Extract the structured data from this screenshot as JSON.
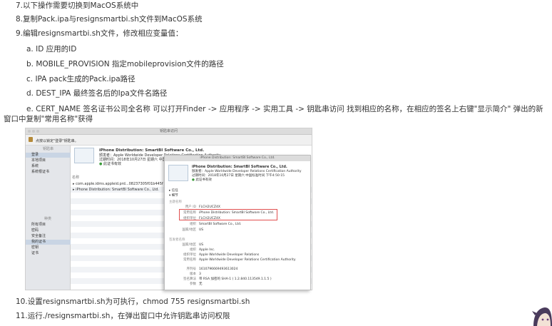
{
  "steps_top": [
    "7.以下操作需要切换到MacOS系统中",
    "8.复制Pack.ipa与resignsmartbi.sh文件到MacOS系统",
    "9.编辑resignsmartbi.sh文件，修改相应变量值："
  ],
  "sub_items": [
    "a. ID  应用的ID",
    "b. MOBILE_PROVISION  指定mobileprovision文件的路径",
    "c.  IPA pack生成的Pack.ipa路径",
    "d.  DEST_IPA 最终签名后的Ipa文件名路径",
    "e.  CERT_NAME 签名证书公司全名称 可以打开Finder -> 应用程序 -> 实用工具 -> 钥匙串访问 找到相应的名称，在相应的签名上右键\"显示简介\" 弹出的新窗口中复制\"常用名称\"获得"
  ],
  "steps_bottom": [
    "10.设置resignsmartbi.sh为可执行，chmod 755 resignsmartbi.sh",
    "11.运行./resignsmartbi.sh，在弹出窗口中允许钥匙串访问权限"
  ],
  "screenshot": {
    "window_title": "钥匙串访问",
    "lock_text": "点按以锁定\"登录\"钥匙串。",
    "sidebar_keychain_header": "钥匙串",
    "sidebar_keychains": [
      "登录",
      "本地项目",
      "系统",
      "系统根证书"
    ],
    "sidebar_category_header": "种类",
    "sidebar_categories": [
      "所有项目",
      "密码",
      "安全备注",
      "我的证书",
      "密钥",
      "证书"
    ],
    "cert_name": "iPhone Distribution: SmartBI Software Co., Ltd.",
    "cert_issuer": "颁发者：Apple Worldwide Developer Relations Certification Authority",
    "cert_expiry": "过期时间：2018年10月27日 星期六 中国标准时间",
    "cert_valid": "此证书有效",
    "list_header": "名称",
    "list_rows": [
      "com.apple.idms.appleid.prd...08237305f01b445f",
      "iPhone Distribution: SmartBI Software Co., Ltd."
    ],
    "detail": {
      "title": "iPhone Distribution: SmartBI Software Co., Ltd.",
      "cert_name": "iPhone Distribution: SmartBI Software Co., Ltd.",
      "cert_issuer": "颁发者：Apple Worldwide Developer Relations Certification Authority",
      "cert_expiry": "过期时间：2018年10月27日 星期六 中国标准时间 下午4:50:15",
      "cert_valid": "此证书有效",
      "trust": "信任",
      "details": "细节",
      "subject_header": "主题名称",
      "subject_rows": [
        {
          "label": "用户 ID",
          "value": "FLCH2UCZ4X"
        },
        {
          "label": "常用名称",
          "value": "iPhone Distribution: SmartBI Software Co., Ltd."
        },
        {
          "label": "组织单位",
          "value": "FLCH2UCZ4X"
        },
        {
          "label": "组织",
          "value": "SmartBI Software Co., Ltd."
        },
        {
          "label": "国家/地区",
          "value": "US"
        }
      ],
      "issuer_header": "签发者名称",
      "issuer_rows": [
        {
          "label": "国家/地区",
          "value": "US"
        },
        {
          "label": "组织",
          "value": "Apple Inc."
        },
        {
          "label": "组织单位",
          "value": "Apple Worldwide Developer Relations"
        },
        {
          "label": "常用名称",
          "value": "Apple Worldwide Developer Relations Certification Authority"
        }
      ],
      "extra_rows": [
        {
          "label": "序列号",
          "value": "1610796669493613024"
        },
        {
          "label": "版本",
          "value": "3"
        },
        {
          "label": "签名算法",
          "value": "带 RSA 加密的 SHA-1 ( 1.2.840.113549.1.1.5 )"
        },
        {
          "label": "参数",
          "value": "无"
        }
      ]
    }
  }
}
